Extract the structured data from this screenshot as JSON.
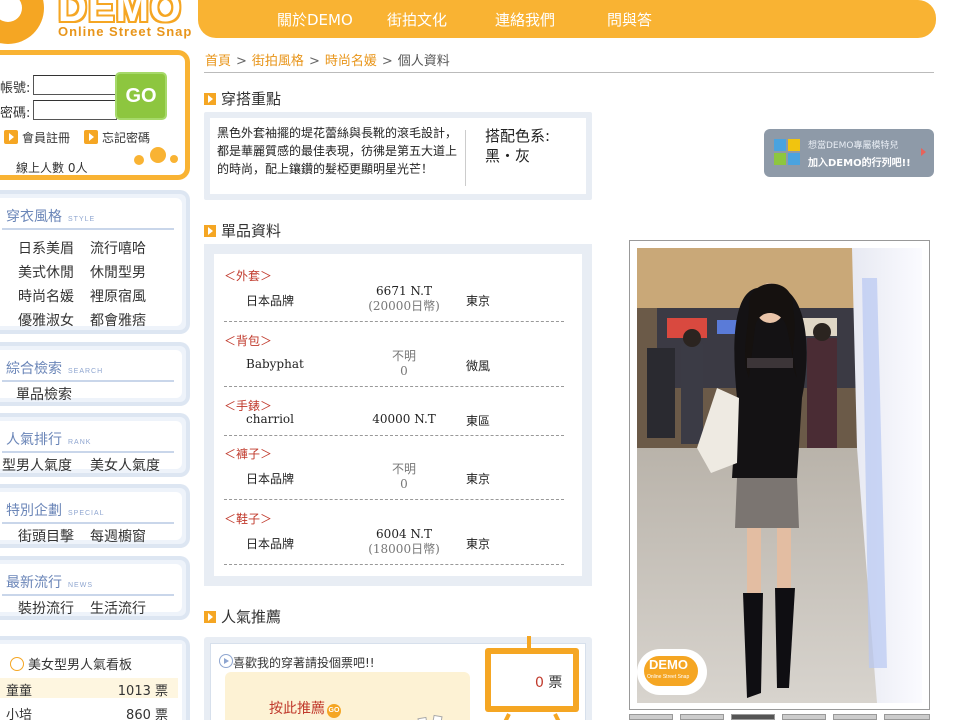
{
  "logo": {
    "text": "DEMO",
    "subtitle": "Online Street Snap"
  },
  "topnav": {
    "items": [
      "關於DEMO",
      "街拍文化",
      "連絡我們",
      "問與答"
    ]
  },
  "login": {
    "account_label": "帳號:",
    "password_label": "密碼:",
    "account_value": "",
    "password_value": "",
    "go_label": "GO",
    "register_label": "會員註冊",
    "forgot_label": "忘記密碼",
    "online_text": "線上人數 0人"
  },
  "sidebar": {
    "style": {
      "title": "穿衣風格",
      "en": "STYLE",
      "links": [
        "日系美眉",
        "流行嘻哈",
        "美式休閒",
        "休閒型男",
        "時尚名媛",
        "裡原宿風",
        "優雅淑女",
        "都會雅痞"
      ]
    },
    "search": {
      "title": "綜合檢索",
      "en": "SEARCH",
      "links": [
        "單品檢索"
      ]
    },
    "rank": {
      "title": "人氣排行",
      "en": "RANK",
      "links": [
        "型男人氣度",
        "美女人氣度"
      ]
    },
    "special": {
      "title": "特別企劃",
      "en": "SPECIAL",
      "links": [
        "街頭目擊",
        "每週櫥窗"
      ]
    },
    "news": {
      "title": "最新流行",
      "en": "NEWS",
      "links": [
        "裝扮流行",
        "生活流行"
      ]
    }
  },
  "leaderboard": {
    "title": "美女型男人氣看板",
    "rows": [
      {
        "name": "童童",
        "votes": "1013 票"
      },
      {
        "name": "小培",
        "votes": "860 票"
      }
    ]
  },
  "breadcrumb": {
    "items": [
      "首頁",
      "街拍風格",
      "時尚名媛"
    ],
    "current": "個人資料",
    "separator": ">"
  },
  "outfit": {
    "heading": "穿搭重點",
    "description": "黑色外套袖擺的堤花蕾絲與長靴的滾毛設計，都是華麗質感的最佳表現，彷彿是第五大道上的時尚，配上鑲鑽的髮椏更顯明星光芒！",
    "color_label": "搭配色系:",
    "color_value": "黑・灰"
  },
  "items": {
    "heading": "單品資料",
    "list": [
      {
        "category": "＜外套＞",
        "brand": "日本品牌",
        "price": "6671  N.T",
        "price_sub": "(20000日幣)",
        "location": "東京"
      },
      {
        "category": "＜背包＞",
        "brand": "Babyphat",
        "price": "不明",
        "price_sub": "0",
        "location": "微風"
      },
      {
        "category": "＜手錶＞",
        "brand": "charriol",
        "price": "40000  N.T",
        "price_sub": "",
        "location": "東區"
      },
      {
        "category": "＜褲子＞",
        "brand": "日本品牌",
        "price": "不明",
        "price_sub": "0",
        "location": "東京"
      },
      {
        "category": "＜鞋子＞",
        "brand": "日本品牌",
        "price": "6004  N.T",
        "price_sub": "(18000日幣)",
        "location": "東京"
      }
    ]
  },
  "recommend": {
    "heading": "人氣推薦",
    "prompt": "喜歡我的穿著請投個票吧!!",
    "button_label": "按此推薦",
    "go_mini": "GO",
    "vote_count": "0",
    "vote_unit": " 票"
  },
  "banner": {
    "line1": "想當DEMO專屬模特兒",
    "line2": "加入DEMO的行列吧!!"
  },
  "photo_logo": {
    "text": "DEMO",
    "subtitle": "Online Street Snap"
  },
  "colors": {
    "accent": "#f9b333",
    "link": "#e8951a",
    "category": "#c0392b",
    "side_border": "#dde6f2",
    "side_title": "#6b86b8",
    "go_green": "#8dc63f"
  }
}
